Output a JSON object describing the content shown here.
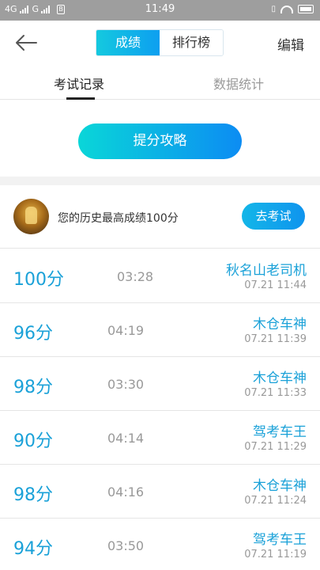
{
  "status_bar": {
    "network1": "4G",
    "network2": "G",
    "sim_label": "B",
    "time": "11:49"
  },
  "header": {
    "segments": [
      "成绩",
      "排行榜"
    ],
    "edit_label": "编辑"
  },
  "tabs": [
    "考试记录",
    "数据统计"
  ],
  "tips_button": "提分攻略",
  "best": {
    "text": "您的历史最高成绩100分",
    "go_button": "去考试"
  },
  "records": [
    {
      "score": "100分",
      "duration": "03:28",
      "title": "秋名山老司机",
      "date": "07.21  11:44"
    },
    {
      "score": "96分",
      "duration": "04:19",
      "title": "木仓车神",
      "date": "07.21  11:39"
    },
    {
      "score": "98分",
      "duration": "03:30",
      "title": "木仓车神",
      "date": "07.21  11:33"
    },
    {
      "score": "90分",
      "duration": "04:14",
      "title": "驾考车王",
      "date": "07.21  11:29"
    },
    {
      "score": "98分",
      "duration": "04:16",
      "title": "木仓车神",
      "date": "07.21  11:24"
    },
    {
      "score": "94分",
      "duration": "03:50",
      "title": "驾考车王",
      "date": "07.21  11:19"
    }
  ],
  "colors": {
    "accent": "#1aa1d8",
    "gradient_start": "#0ad6d8",
    "gradient_end": "#0c8cf3"
  }
}
